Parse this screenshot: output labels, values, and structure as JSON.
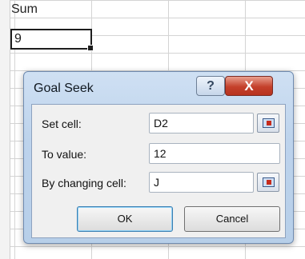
{
  "sheet": {
    "header_value": "Sum",
    "cell_value": "9"
  },
  "dialog": {
    "title": "Goal Seek",
    "help_label": "?",
    "close_label": "X",
    "set_cell": {
      "label": "Set cell:",
      "value": "D2"
    },
    "to_value": {
      "label": "To value:",
      "value": "12"
    },
    "changing_cell": {
      "label": "By changing cell:",
      "value": "J"
    },
    "ok_label": "OK",
    "cancel_label": "Cancel"
  },
  "colors": {
    "close_button": "#c4402b",
    "dialog_frame": "#bdd3ec",
    "ok_focus": "#3c7fb1"
  },
  "icons": {
    "range_select": "range-select-icon"
  }
}
